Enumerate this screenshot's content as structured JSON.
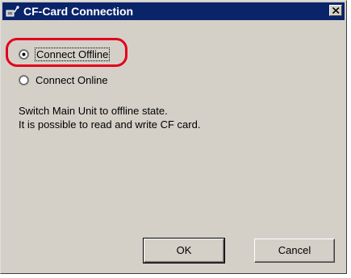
{
  "window": {
    "title": "CF-Card Connection",
    "icon": "cf-card-connection-icon",
    "close_icon": "close-icon"
  },
  "options": {
    "offline": {
      "label": "Connect Offline",
      "selected": true
    },
    "online": {
      "label": "Connect Online",
      "selected": false
    }
  },
  "description": {
    "line1": "Switch Main Unit to offline state.",
    "line2": "It is possible to read and write CF card."
  },
  "buttons": {
    "ok_label": "OK",
    "cancel_label": "Cancel"
  },
  "colors": {
    "titlebar": "#0a246a",
    "dialog_bg": "#d4d0c8",
    "highlight": "#e3001b"
  }
}
